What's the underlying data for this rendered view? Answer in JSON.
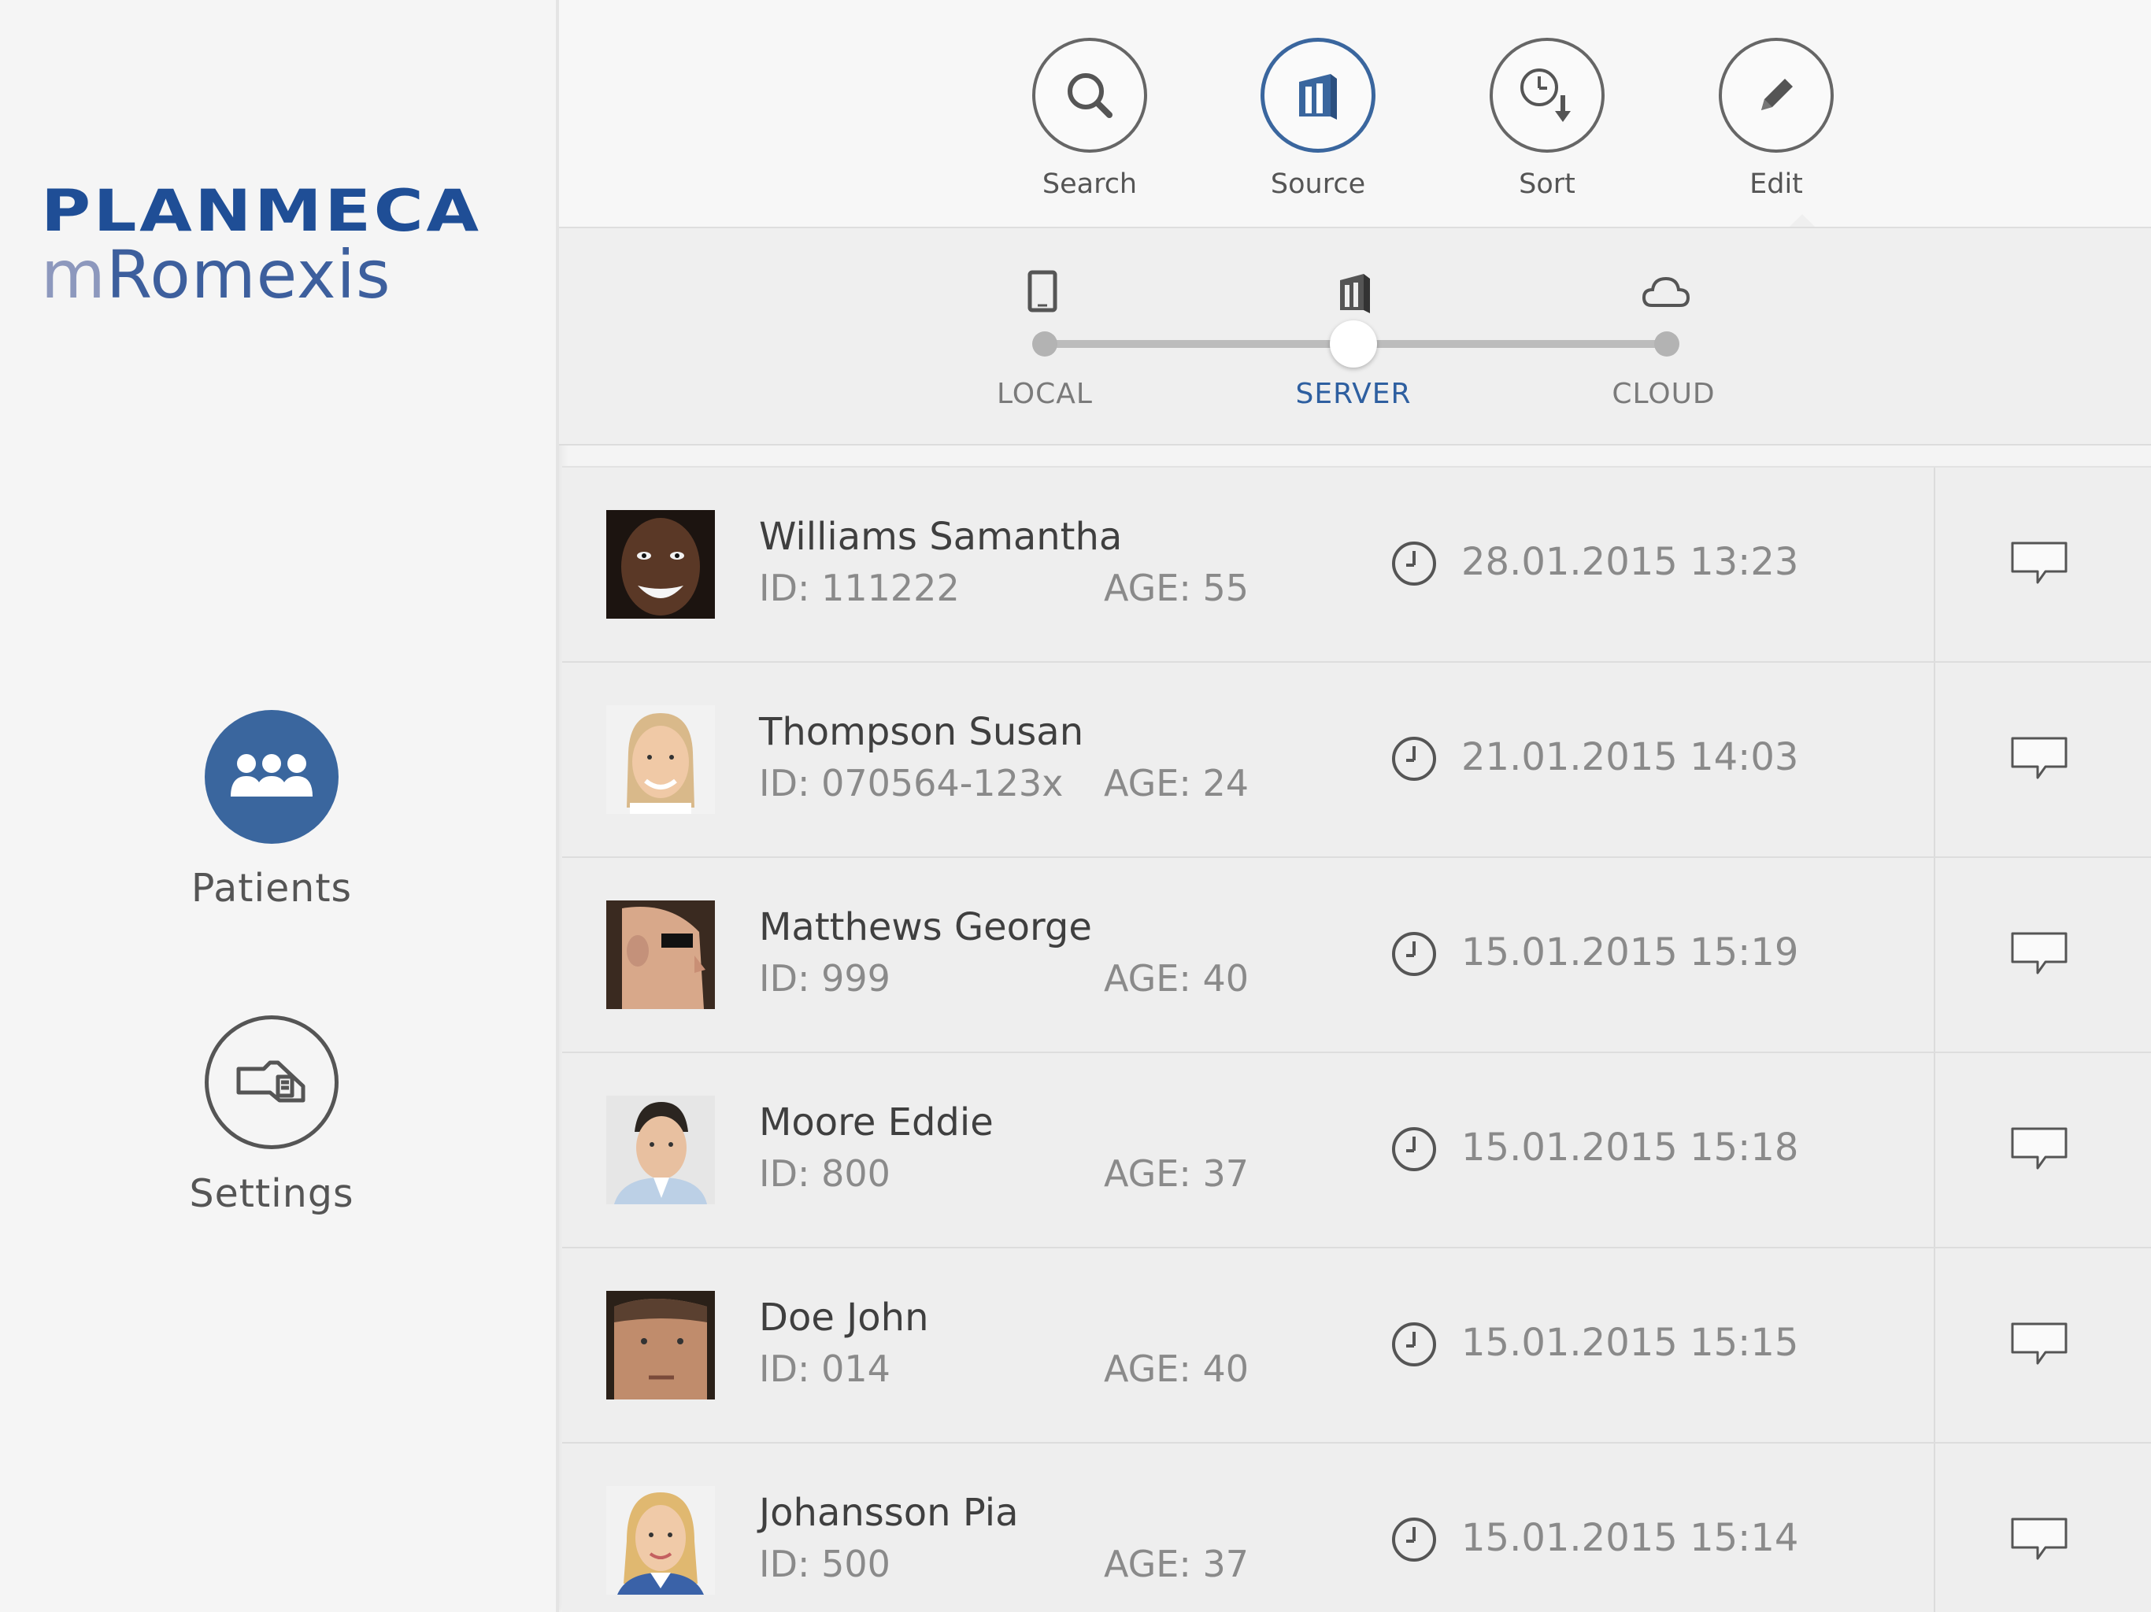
{
  "sidebar": {
    "logo_brand": "PLANMECA",
    "logo_product_prefix": "m",
    "logo_product_rest": "Romexis",
    "nav": [
      {
        "label": "Patients",
        "icon": "patients-icon",
        "active": true
      },
      {
        "label": "Settings",
        "icon": "settings-icon",
        "active": false
      }
    ]
  },
  "toolbar": {
    "tools": [
      {
        "label": "Search",
        "icon": "search-icon"
      },
      {
        "label": "Source",
        "icon": "server-icon",
        "active": true
      },
      {
        "label": "Sort",
        "icon": "sort-clock-icon"
      },
      {
        "label": "Edit",
        "icon": "pencil-icon"
      }
    ]
  },
  "source": {
    "options": [
      {
        "label": "LOCAL",
        "icon": "tablet-icon"
      },
      {
        "label": "SERVER",
        "icon": "server-icon"
      },
      {
        "label": "CLOUD",
        "icon": "cloud-icon"
      }
    ],
    "selected": "SERVER"
  },
  "patients": [
    {
      "name": "Williams Samantha",
      "id": "ID: 111222",
      "age": "AGE: 55",
      "date": "28.01.2015 13:23"
    },
    {
      "name": "Thompson Susan",
      "id": "ID: 070564-123x",
      "age": "AGE: 24",
      "date": "21.01.2015 14:03"
    },
    {
      "name": "Matthews George",
      "id": "ID: 999",
      "age": "AGE: 40",
      "date": "15.01.2015 15:19"
    },
    {
      "name": "Moore Eddie",
      "id": "ID: 800",
      "age": "AGE: 37",
      "date": "15.01.2015 15:18"
    },
    {
      "name": "Doe John",
      "id": "ID: 014",
      "age": "AGE: 40",
      "date": "15.01.2015 15:15"
    },
    {
      "name": "Johansson Pia",
      "id": "ID: 500",
      "age": "AGE: 37",
      "date": "15.01.2015 15:14"
    }
  ],
  "colors": {
    "accent": "#3a669e",
    "brand": "#1f4e96"
  }
}
